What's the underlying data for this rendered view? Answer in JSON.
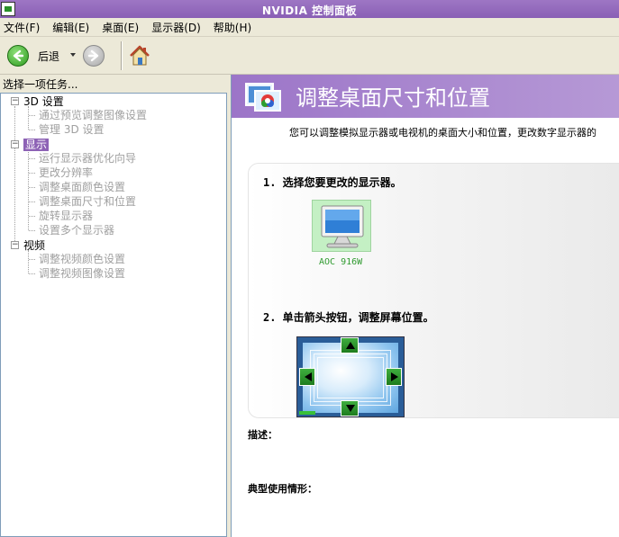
{
  "window": {
    "title": "NVIDIA 控制面板"
  },
  "menu": [
    "文件(F)",
    "编辑(E)",
    "桌面(E)",
    "显示器(D)",
    "帮助(H)"
  ],
  "toolbar": {
    "back_label": "后退"
  },
  "left": {
    "header": "选择一项任务...",
    "tree": [
      {
        "label": "3D 设置",
        "children": [
          "通过预览调整图像设置",
          "管理 3D 设置"
        ]
      },
      {
        "label": "显示",
        "children": [
          "运行显示器优化向导",
          "更改分辨率",
          "调整桌面颜色设置",
          "调整桌面尺寸和位置",
          "旋转显示器",
          "设置多个显示器"
        ]
      },
      {
        "label": "视频",
        "children": [
          "调整视频颜色设置",
          "调整视频图像设置"
        ]
      }
    ]
  },
  "right": {
    "title": "调整桌面尺寸和位置",
    "intro": "您可以调整模拟显示器或电视机的桌面大小和位置，更改数字显示器的",
    "step1": "1. 选择您要更改的显示器。",
    "monitor_name": "AOC 916W",
    "step2": "2. 单击箭头按钮，调整屏幕位置。",
    "desc_label": "描述：",
    "usage_label": "典型使用情形："
  }
}
